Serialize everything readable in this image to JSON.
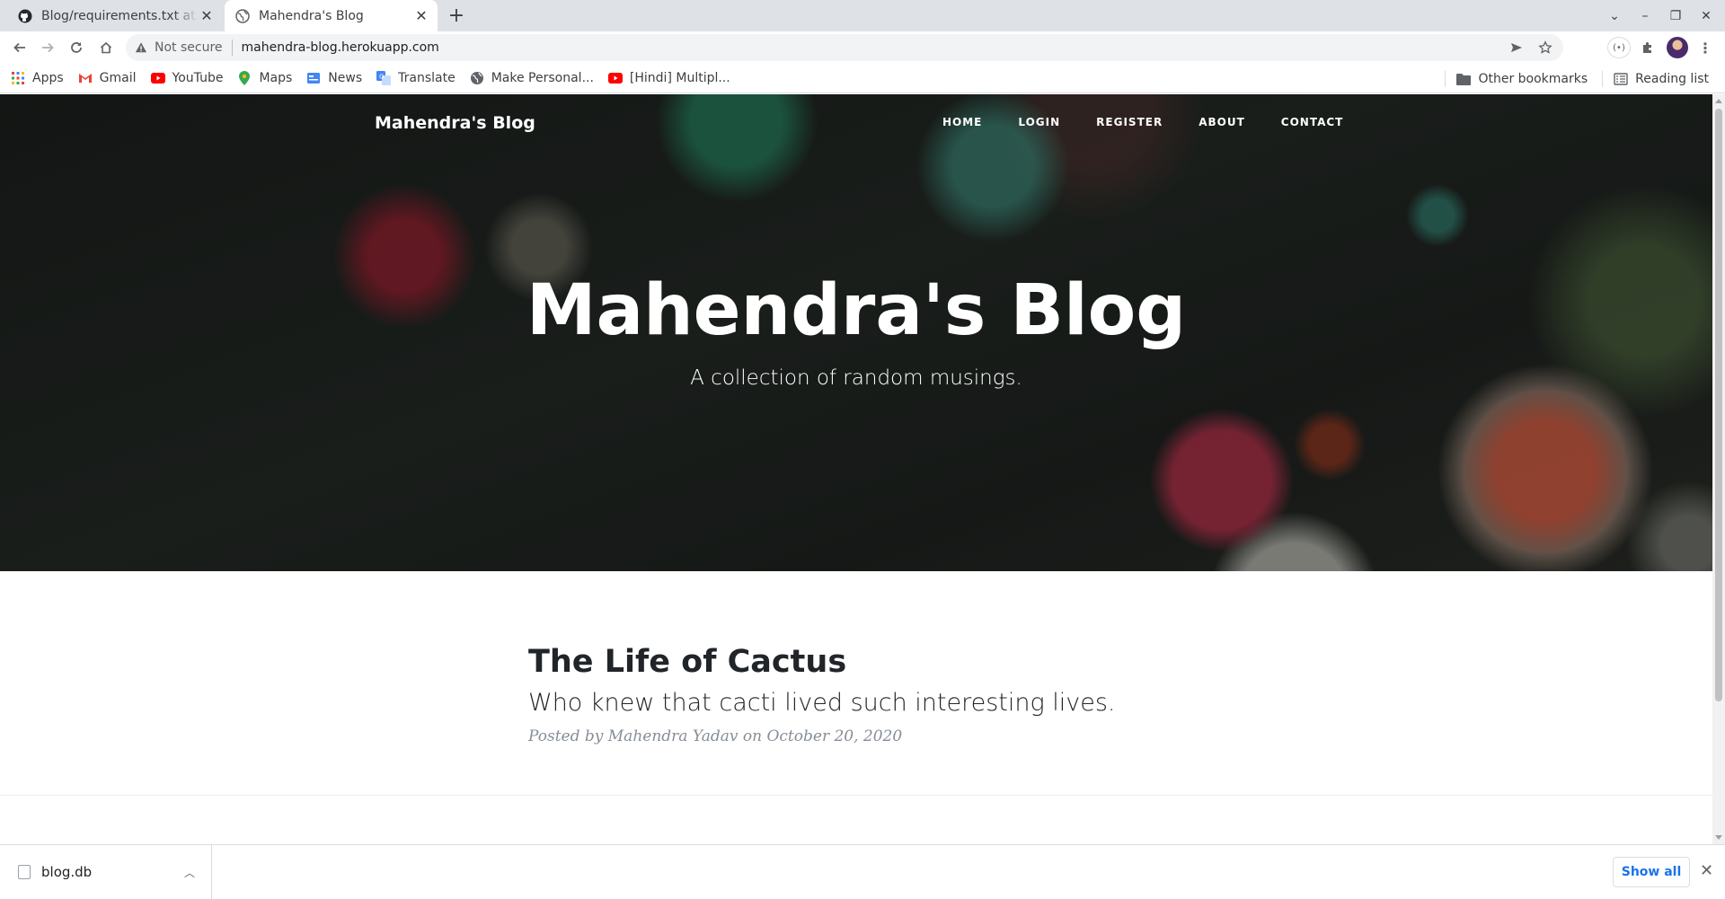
{
  "browser": {
    "tabs": [
      {
        "title": "Blog/requirements.txt at",
        "icon": "github-icon",
        "active": false
      },
      {
        "title": "Mahendra's Blog",
        "icon": "globe-icon",
        "active": true
      }
    ],
    "new_tab": "+",
    "omnibox": {
      "security_label": "Not secure",
      "url": "mahendra-blog.herokuapp.com"
    },
    "bookmarks": [
      {
        "label": "Apps",
        "icon": "apps-grid-icon"
      },
      {
        "label": "Gmail",
        "icon": "gmail-icon"
      },
      {
        "label": "YouTube",
        "icon": "youtube-icon"
      },
      {
        "label": "Maps",
        "icon": "maps-pin-icon"
      },
      {
        "label": "News",
        "icon": "news-icon"
      },
      {
        "label": "Translate",
        "icon": "translate-icon"
      },
      {
        "label": "Make Personal...",
        "icon": "globe-icon"
      },
      {
        "label": "[Hindi] Multipl...",
        "icon": "youtube-icon"
      }
    ],
    "other_bookmarks": "Other bookmarks",
    "reading_list": "Reading list"
  },
  "site": {
    "brand": "Mahendra's Blog",
    "nav": [
      "HOME",
      "LOGIN",
      "REGISTER",
      "ABOUT",
      "CONTACT"
    ],
    "hero_title": "Mahendra's Blog",
    "hero_subtitle": "A collection of random musings."
  },
  "posts": [
    {
      "title": "The Life of Cactus",
      "subtitle": "Who knew that cacti lived such interesting lives.",
      "meta": "Posted by Mahendra Yadav on October 20, 2020"
    }
  ],
  "downloads": {
    "file": "blog.db",
    "show_all": "Show all"
  },
  "colors": {
    "tabstrip": "#dee1e6",
    "link_blue": "#1a73e8",
    "post_title": "#212529",
    "meta_gray": "#868e96"
  }
}
